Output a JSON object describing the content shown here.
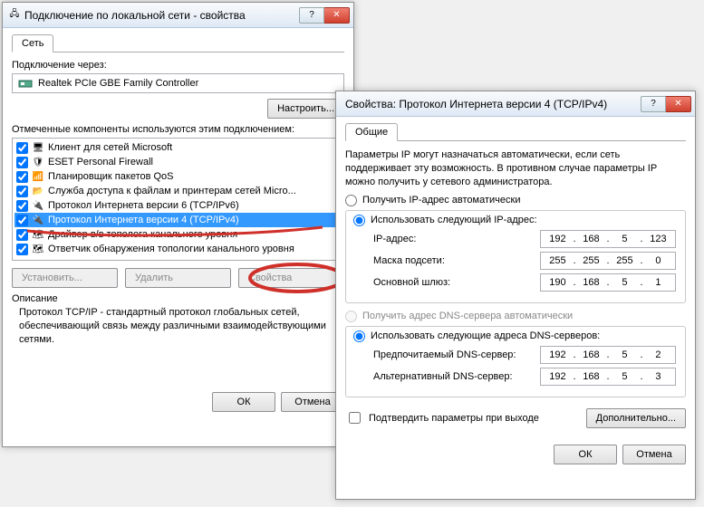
{
  "win1": {
    "title": "Подключение по локальной сети - свойства",
    "tab": "Сеть",
    "connect_label": "Подключение через:",
    "nic": "Realtek PCIe GBE Family Controller",
    "configure_btn": "Настроить...",
    "components_label": "Отмеченные компоненты используются этим подключением:",
    "items": [
      "Клиент для сетей Microsoft",
      "ESET Personal Firewall",
      "Планировщик пакетов QoS",
      "Служба доступа к файлам и принтерам сетей Micro...",
      "Протокол Интернета версии 6 (TCP/IPv6)",
      "Протокол Интернета версии 4 (TCP/IPv4)",
      "Драйвер в/в тополога канального уровня",
      "Ответчик обнаружения топологии канального уровня"
    ],
    "install_btn": "Установить...",
    "remove_btn": "Удалить",
    "props_btn": "Свойства",
    "desc_label": "Описание",
    "desc_text": "Протокол TCP/IP - стандартный протокол глобальных сетей, обеспечивающий связь между различными взаимодействующими сетями.",
    "ok": "ОК",
    "cancel": "Отмена"
  },
  "win2": {
    "title": "Свойства: Протокол Интернета версии 4 (TCP/IPv4)",
    "tab": "Общие",
    "intro": "Параметры IP могут назначаться автоматически, если сеть поддерживает эту возможность. В противном случае параметры IP можно получить у сетевого администратора.",
    "radio_auto_ip": "Получить IP-адрес автоматически",
    "radio_manual_ip": "Использовать следующий IP-адрес:",
    "lbl_ip": "IP-адрес:",
    "val_ip": {
      "a": "192",
      "b": "168",
      "c": "5",
      "d": "123"
    },
    "lbl_mask": "Маска подсети:",
    "val_mask": {
      "a": "255",
      "b": "255",
      "c": "255",
      "d": "0"
    },
    "lbl_gw": "Основной шлюз:",
    "val_gw": {
      "a": "190",
      "b": "168",
      "c": "5",
      "d": "1"
    },
    "radio_auto_dns": "Получить адрес DNS-сервера автоматически",
    "radio_manual_dns": "Использовать следующие адреса DNS-серверов:",
    "lbl_dns1": "Предпочитаемый DNS-сервер:",
    "val_dns1": {
      "a": "192",
      "b": "168",
      "c": "5",
      "d": "2"
    },
    "lbl_dns2": "Альтернативный DNS-сервер:",
    "val_dns2": {
      "a": "192",
      "b": "168",
      "c": "5",
      "d": "3"
    },
    "chk_validate": "Подтвердить параметры при выходе",
    "advanced_btn": "Дополнительно...",
    "ok": "ОК",
    "cancel": "Отмена"
  }
}
